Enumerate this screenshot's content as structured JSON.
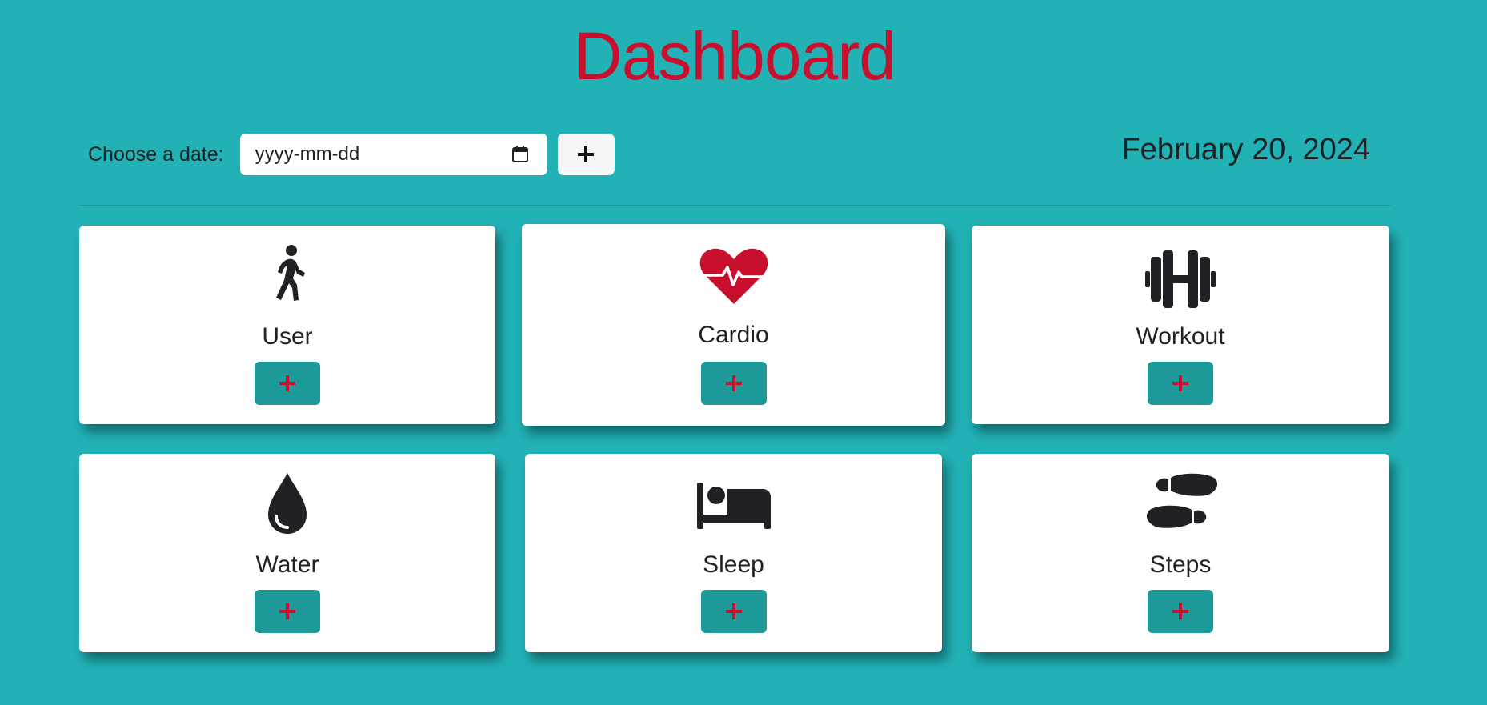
{
  "header": {
    "title": "Dashboard"
  },
  "date_picker": {
    "label": "Choose a date:",
    "placeholder": "yyyy-mm-dd",
    "value": ""
  },
  "current_date": "February 20, 2024",
  "cards": [
    {
      "title": "User",
      "icon": "walking-person-icon"
    },
    {
      "title": "Cardio",
      "icon": "heart-pulse-icon"
    },
    {
      "title": "Workout",
      "icon": "dumbbell-icon"
    },
    {
      "title": "Water",
      "icon": "water-drop-icon"
    },
    {
      "title": "Sleep",
      "icon": "bed-icon"
    },
    {
      "title": "Steps",
      "icon": "shoe-prints-icon"
    }
  ],
  "colors": {
    "background": "#22b2b6",
    "title": "#c8102e",
    "heart": "#c8102e",
    "plus": "#c8102e",
    "card_button": "#1d999a",
    "text": "#1f2124"
  }
}
